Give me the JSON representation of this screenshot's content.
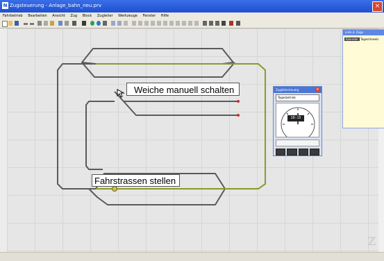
{
  "window": {
    "title": "Zugsteuerung - Anlage_bahn_neu.prv",
    "app_icon": "app-icon",
    "close_label": "×"
  },
  "menu": {
    "items": [
      "Fahrbetrieb",
      "Bearbeiten",
      "Ansicht",
      "Zug",
      "Block",
      "Zugleiter",
      "Werkzeuge",
      "Fenster",
      "Hilfe"
    ]
  },
  "toolbar": {
    "icons": [
      "new-icon",
      "open-icon",
      "save-icon",
      "undo-icon",
      "redo-icon",
      "cut-icon",
      "copy-icon",
      "paste-icon",
      "zoom-icon",
      "print-icon",
      "help-icon",
      "green-signal-icon",
      "blue-signal-icon",
      "mode-icon",
      "table-icon",
      "list-icon",
      "grid-icon",
      "block-icon",
      "route-icon",
      "train-icon",
      "stop-icon",
      "go-icon",
      "edit-icon"
    ]
  },
  "callouts": {
    "turnout": "Weiche manuell schalten",
    "routes": "Fahrstrassen stellen"
  },
  "right_panel": {
    "title": "Liste d. Züge",
    "selected": "Tageshinweis",
    "tag": "Kalender"
  },
  "clock": {
    "title": "Zugleitersteuerg",
    "mode": "Tagesbetrieb",
    "digital": "10:15",
    "accent": "#4a76d8"
  },
  "colors": {
    "track_dark": "#5a5a5a",
    "track_active": "#8a9a2a",
    "canvas": "#e6e6e6"
  }
}
